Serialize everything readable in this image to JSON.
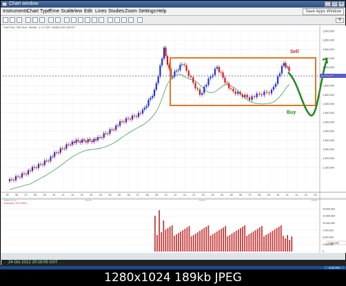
{
  "window": {
    "title": "Chart window",
    "brand_button": "Save Apps Window"
  },
  "menu": [
    "Instruments",
    "Chart Type",
    "Time Scale",
    "View",
    "Edit",
    "Lines",
    "Studies",
    "Zoom",
    "Settings",
    "Help"
  ],
  "chart_header": "Gold Price, USD Spot , Weekly , # 1,0 1300 , MA(50) 26x1 456 607",
  "price_axis": [
    "1,900.000",
    "1,850.000",
    "1,800.000",
    "1,750.000",
    "1,700.000",
    "1,650.000",
    "1,600.000",
    "1,550.000",
    "1,500.000",
    "1,450.000",
    "1,400.000",
    "1,350.000",
    "1,300.000",
    "1,250.000",
    "1,200.000",
    "1,150.000"
  ],
  "current_price_label": "1,720.000",
  "x_axis": {
    "months": [
      "05",
      "06",
      "07",
      "08",
      "09",
      "10",
      "11",
      "12",
      "01",
      "02",
      "03",
      "04",
      "05",
      "06",
      "07",
      "08",
      "09",
      "10",
      "11",
      "12",
      "01",
      "02",
      "03",
      "04",
      "05",
      "06",
      "07",
      "08",
      "09",
      "10",
      "11",
      "12",
      "01",
      "02"
    ],
    "years": [
      "May 03 09",
      "2011",
      "2012",
      "2013"
    ]
  },
  "annotations": {
    "sell": "Sell",
    "buy": "Buy"
  },
  "volume_panel": {
    "label": "Volume(1,225,300)",
    "axis": [
      "15,000,000",
      "12,500,000",
      "10,000,000",
      "7,500,000",
      "5,000,000",
      "2,500,000",
      "0"
    ],
    "current_label": "3,500,000"
  },
  "status_text": "24 Oct 2012 20:18:05 GST",
  "tray_time": "8:20 PM",
  "caption": "1280x1024  189kb  JPEG",
  "colors": {
    "up_candle": "#1d2fd0",
    "down_candle": "#d01818",
    "ma_line": "#3a9a5a",
    "range_box": "#e0781e",
    "forecast": "#1f8a1f",
    "sell_text": "#cc2020",
    "buy_text": "#1f8a1f",
    "volume_bar": "#c43a3a",
    "price_line": "#3a3ab0"
  }
}
